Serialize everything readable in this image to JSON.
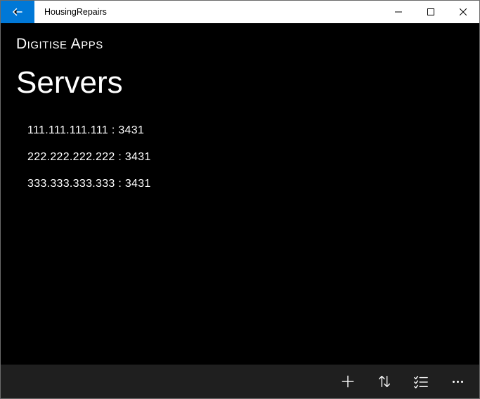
{
  "window": {
    "title": "HousingRepairs"
  },
  "brand": "Digitise Apps",
  "page": {
    "heading": "Servers"
  },
  "servers": [
    {
      "display": "111.111.111.111  :  3431"
    },
    {
      "display": "222.222.222.222  :  3431"
    },
    {
      "display": "333.333.333.333  :  3431"
    }
  ],
  "icons": {
    "back": "back-arrow",
    "minimize": "minimize",
    "maximize": "maximize",
    "close": "close",
    "add": "plus",
    "sort": "sort-arrows",
    "checklist": "checklist",
    "more": "more-ellipsis"
  }
}
